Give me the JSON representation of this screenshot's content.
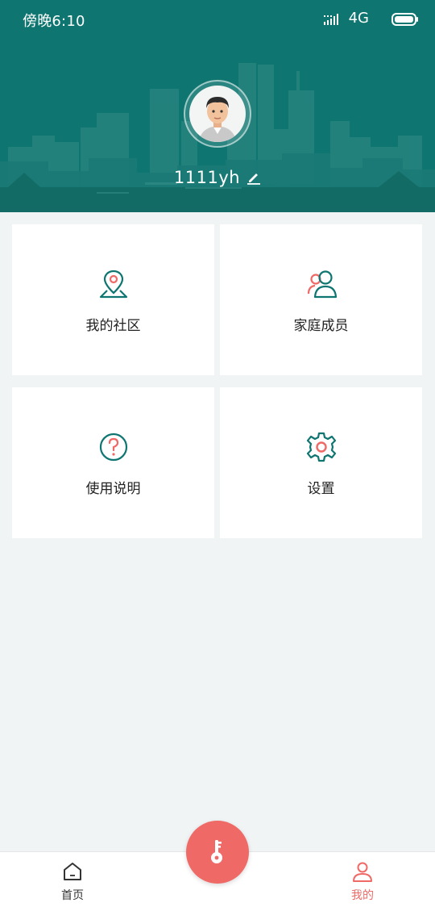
{
  "status_bar": {
    "time": "傍晚6:10",
    "network": "4G",
    "icons": [
      "signal-icon",
      "battery-icon"
    ]
  },
  "profile": {
    "username": "1111yh",
    "avatar_icon": "user-avatar",
    "edit_icon": "pencil-icon"
  },
  "menu": [
    {
      "label": "我的社区",
      "icon": "location-pin-icon"
    },
    {
      "label": "家庭成员",
      "icon": "family-members-icon"
    },
    {
      "label": "使用说明",
      "icon": "question-circle-icon"
    },
    {
      "label": "设置",
      "icon": "gear-icon"
    }
  ],
  "bottom_nav": {
    "home_label": "首页",
    "mine_label": "我的",
    "center_button_icon": "key-icon"
  },
  "colors": {
    "primary_teal": "#0e7570",
    "accent_coral": "#ef6a66",
    "background": "#f1f4f5"
  }
}
